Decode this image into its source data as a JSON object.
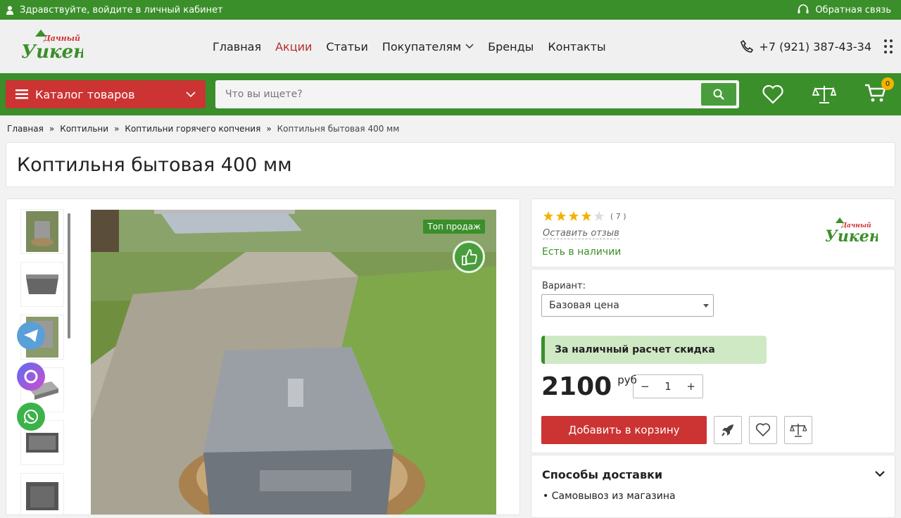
{
  "topbar": {
    "login_text": "Здравствуйте, войдите в личный кабинет",
    "callback_text": "Обратная связь"
  },
  "header": {
    "logo_top": "Дачный",
    "logo_main": "Уикенд",
    "nav": [
      {
        "label": "Главная"
      },
      {
        "label": "Акции"
      },
      {
        "label": "Статьи"
      },
      {
        "label": "Покупателям"
      },
      {
        "label": "Бренды"
      },
      {
        "label": "Контакты"
      }
    ],
    "phone": "+7 (921) 387-43-34"
  },
  "toolbar": {
    "catalog_label": "Каталог товаров",
    "search_placeholder": "Что вы ищете?",
    "cart_count": "0"
  },
  "breadcrumbs": [
    "Главная",
    "Коптильни",
    "Коптильни горячего копчения",
    "Коптильня бытовая 400 мм"
  ],
  "breadcrumb_sep": "»",
  "product": {
    "title": "Коптильня бытовая 400 мм",
    "badge": "Топ продаж",
    "rating": 4,
    "rating_max": 5,
    "review_count": "( 7 )",
    "leave_review": "Оставить отзыв",
    "stock": "Есть в наличии",
    "variant_label": "Вариант:",
    "variant_value": "Базовая цена",
    "discount_text": "За наличный расчет скидка",
    "price": "2100",
    "currency": "руб",
    "qty": "1",
    "qty_minus": "−",
    "qty_plus": "+",
    "add_to_cart": "Добавить в корзину"
  },
  "delivery": {
    "title": "Способы доставки",
    "items": [
      "• Самовывоз из магазина"
    ]
  },
  "colors": {
    "green": "#3a8f2a",
    "red": "#cc3333",
    "light_green": "#cfe9c4",
    "yellow": "#f2b400"
  }
}
